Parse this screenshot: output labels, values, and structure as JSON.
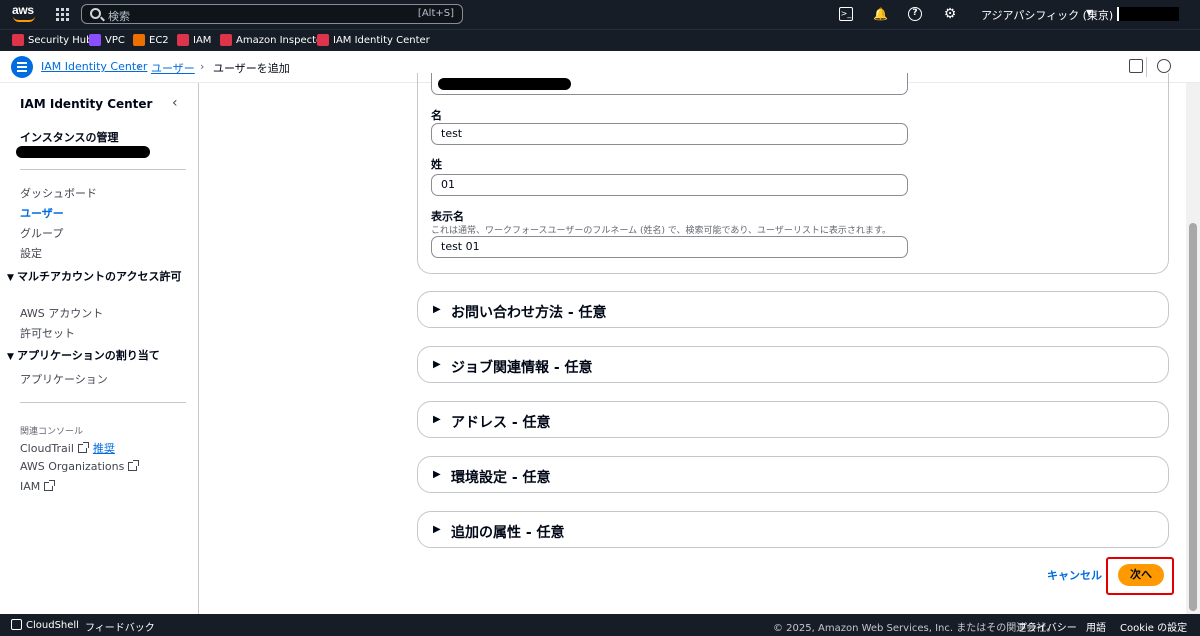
{
  "topbar": {
    "logo_text": "aws",
    "search_placeholder": "検索",
    "search_shortcut": "[Alt+S]",
    "region": "アジアパシフィック (東京)",
    "icons": [
      "cloudshell-icon",
      "bell-icon",
      "help-icon",
      "gear-icon"
    ]
  },
  "favorites": [
    {
      "label": "Security Hub",
      "color": "#dd344c"
    },
    {
      "label": "VPC",
      "color": "#8c4fff"
    },
    {
      "label": "EC2",
      "color": "#ed7100"
    },
    {
      "label": "IAM",
      "color": "#dd344c"
    },
    {
      "label": "Amazon Inspector",
      "color": "#dd344c"
    },
    {
      "label": "IAM Identity Center",
      "color": "#dd344c"
    }
  ],
  "breadcrumb": {
    "items": [
      "IAM Identity Center",
      "ユーザー",
      "ユーザーを追加"
    ]
  },
  "sidebar": {
    "title": "IAM Identity Center",
    "instance_section": "インスタンスの管理",
    "items": [
      "ダッシュボード",
      "ユーザー",
      "グループ",
      "設定"
    ],
    "group_multi": "マルチアカウントのアクセス許可",
    "multi_items": [
      "AWS アカウント",
      "許可セット"
    ],
    "group_apps": "アプリケーションの割り当て",
    "app_items": [
      "アプリケーション"
    ],
    "related_label": "関連コンソール",
    "related": [
      {
        "label": "CloudTrail",
        "extra": "推奨"
      },
      {
        "label": "AWS Organizations"
      },
      {
        "label": "IAM"
      }
    ]
  },
  "form": {
    "first_name_label": "名",
    "first_name_value": "test",
    "last_name_label": "姓",
    "last_name_value": "01",
    "display_name_label": "表示名",
    "display_name_desc": "これは通常、ワークフォースユーザーのフルネーム (姓名) で、検索可能であり、ユーザーリストに表示されます。",
    "display_name_value": "test 01"
  },
  "sections": [
    "お問い合わせ方法 - 任意",
    "ジョブ関連情報 - 任意",
    "アドレス - 任意",
    "環境設定 - 任意",
    "追加の属性 - 任意"
  ],
  "actions": {
    "cancel": "キャンセル",
    "next": "次へ"
  },
  "footer": {
    "cloudshell": "CloudShell",
    "feedback": "フィードバック",
    "copyright": "© 2025, Amazon Web Services, Inc. またはその関連会社。",
    "privacy": "プライバシー",
    "terms": "用語",
    "cookies": "Cookie の設定"
  }
}
